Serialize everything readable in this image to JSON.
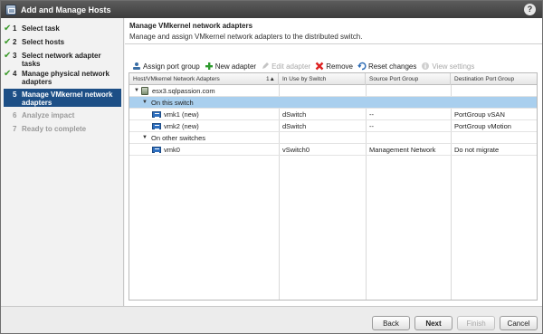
{
  "window": {
    "title": "Add and Manage Hosts",
    "help_label": "?"
  },
  "steps": [
    {
      "num": "1",
      "label": "Select task",
      "state": "done"
    },
    {
      "num": "2",
      "label": "Select hosts",
      "state": "done"
    },
    {
      "num": "3",
      "label": "Select network adapter tasks",
      "state": "done"
    },
    {
      "num": "4",
      "label": "Manage physical network adapters",
      "state": "done"
    },
    {
      "num": "5",
      "label": "Manage VMkernel network adapters",
      "state": "active"
    },
    {
      "num": "6",
      "label": "Analyze impact",
      "state": "disabled"
    },
    {
      "num": "7",
      "label": "Ready to complete",
      "state": "disabled"
    }
  ],
  "content": {
    "title": "Manage VMkernel network adapters",
    "subtitle": "Manage and assign VMkernel network adapters to the distributed switch."
  },
  "toolbar": {
    "assign_port_group": "Assign port group",
    "new_adapter": "New adapter",
    "edit_adapter": "Edit adapter",
    "remove": "Remove",
    "reset_changes": "Reset changes",
    "view_settings": "View settings"
  },
  "grid": {
    "columns": [
      "Host/VMkernel Network Adapters",
      "In Use by Switch",
      "Source Port Group",
      "Destination Port Group"
    ],
    "sort_indicator": "1▲",
    "host": "esx3.sqlpassion.com",
    "group_this_switch": "On this switch",
    "group_other_switches": "On other switches",
    "rows": [
      {
        "adapter": "vmk1 (new)",
        "switch": "dSwitch",
        "source": "--",
        "destination": "PortGroup vSAN"
      },
      {
        "adapter": "vmk2 (new)",
        "switch": "dSwitch",
        "source": "--",
        "destination": "PortGroup vMotion"
      },
      {
        "adapter": "vmk0",
        "switch": "vSwitch0",
        "source": "Management Network",
        "destination": "Do not migrate"
      }
    ]
  },
  "footer": {
    "back": "Back",
    "next": "Next",
    "finish": "Finish",
    "cancel": "Cancel"
  },
  "colors": {
    "active_step": "#1d4f86",
    "row_highlight": "#a9cfee",
    "check": "#3b9a2b"
  }
}
